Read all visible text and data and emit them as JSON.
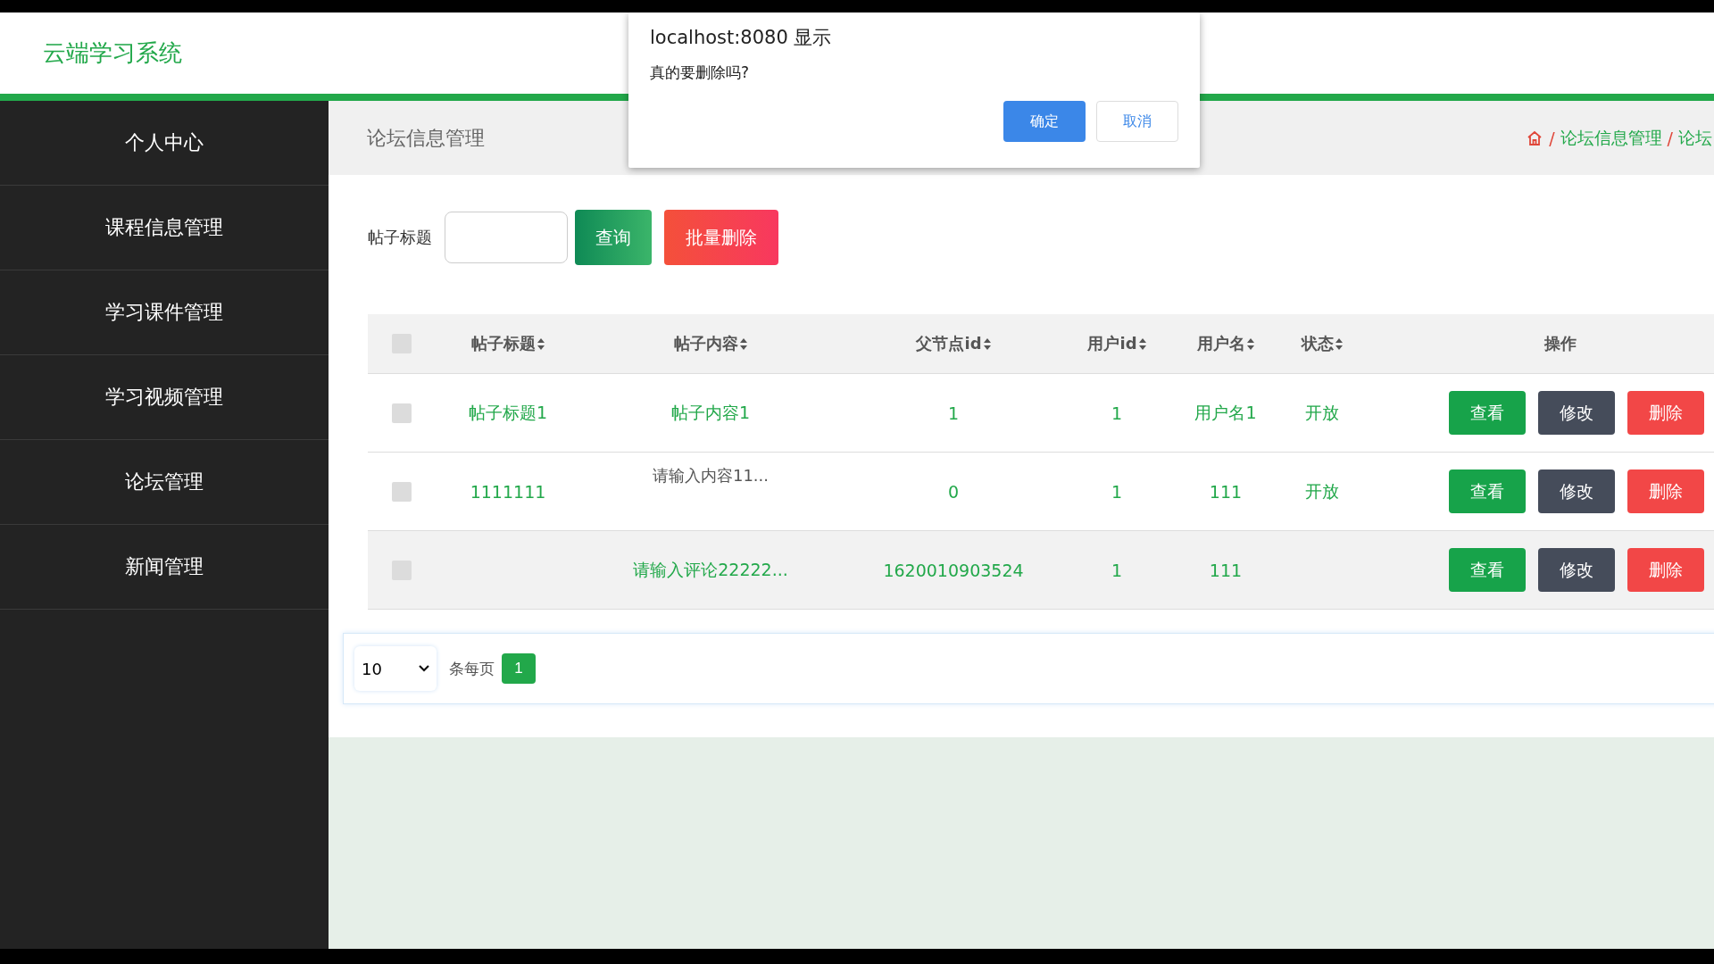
{
  "header": {
    "title": "云端学习系统"
  },
  "sidebar": {
    "items": [
      {
        "label": "个人中心",
        "selected": false
      },
      {
        "label": "课程信息管理",
        "selected": false
      },
      {
        "label": "学习课件管理",
        "selected": false
      },
      {
        "label": "学习视频管理",
        "selected": false
      },
      {
        "label": "论坛管理",
        "selected": false
      },
      {
        "label": "新闻管理",
        "selected": false
      }
    ]
  },
  "page_title": "论坛信息管理",
  "breadcrumb": [
    "/",
    "论坛信息管理",
    "/",
    "论坛"
  ],
  "search": {
    "label": "帖子标题",
    "button": "查询",
    "delete_button": "批量删除"
  },
  "table": {
    "select_all_checked": false,
    "columns": [
      "帖子标题",
      "帖子内容",
      "父节点id",
      "用户id",
      "用户名",
      "状态",
      "操作"
    ],
    "rows": [
      {
        "title": "帖子标题1",
        "content": "帖子内容1",
        "greyed": false,
        "parent_id": "1",
        "user_id": "1",
        "username": "用户名1",
        "status": "开放",
        "checked": false,
        "highlighted": false,
        "actions": [
          "查看",
          "修改",
          "删除"
        ]
      },
      {
        "title": "1111111",
        "content": "请输入内容11...",
        "greyed": true,
        "parent_id": "0",
        "user_id": "1",
        "username": "111",
        "status": "开放",
        "checked": false,
        "highlighted": false,
        "actions": [
          "查看",
          "修改",
          "删除"
        ]
      },
      {
        "content": "请输入评论22222...",
        "greyed": false,
        "parent_id": "1620010903524",
        "user_id": "1",
        "username": "111",
        "checked": false,
        "highlighted": true,
        "actions": [
          "查看",
          "修改",
          "删除"
        ]
      }
    ]
  },
  "pagination": {
    "page_size": "10",
    "per_page_label": "条每页",
    "pages": [
      {
        "label": "1",
        "selected": true
      }
    ]
  },
  "dialog": {
    "title": "localhost:8080 显示",
    "message": "真的要删除吗?",
    "ok": "确定",
    "cancel": "取消"
  }
}
